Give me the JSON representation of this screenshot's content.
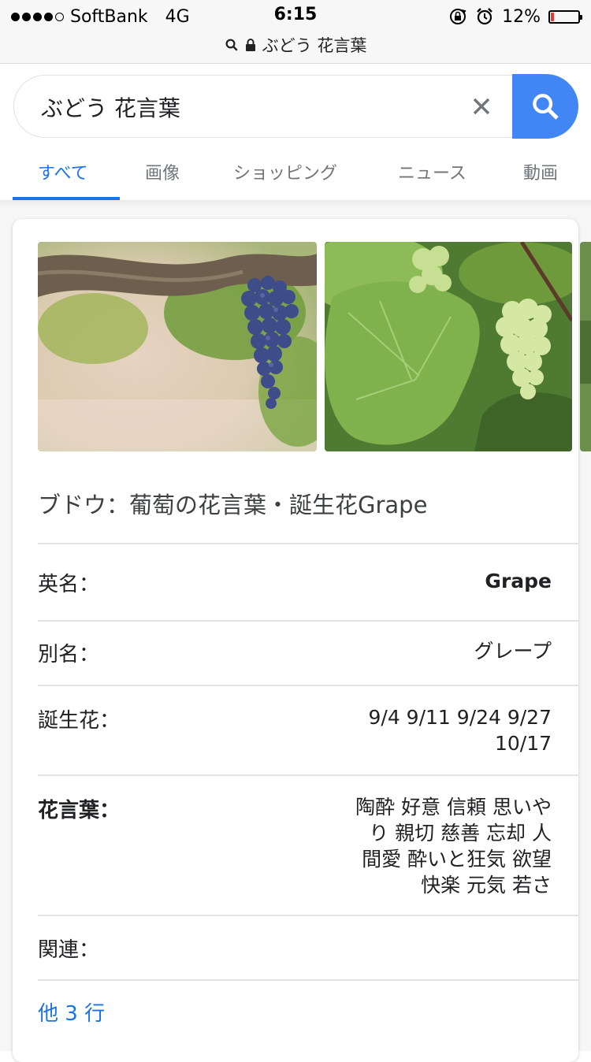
{
  "status_bar": {
    "carrier": "SoftBank",
    "network": "4G",
    "time": "6:15",
    "battery": "12%",
    "battery_level": 0.12,
    "signal_bars_filled": 4,
    "signal_bars_total": 5,
    "icons": [
      "lock-rotation-icon",
      "alarm-icon",
      "battery-icon"
    ]
  },
  "url_bar": {
    "text": "ぶどう 花言葉",
    "icons": [
      "search-icon",
      "lock-icon"
    ]
  },
  "search": {
    "query": "ぶどう 花言葉",
    "clear_icon": "close-icon",
    "submit_icon": "search-icon"
  },
  "tabs": [
    {
      "label": "すべて",
      "active": true
    },
    {
      "label": "画像",
      "active": false
    },
    {
      "label": "ショッピング",
      "active": false
    },
    {
      "label": "ニュース",
      "active": false
    },
    {
      "label": "動画",
      "active": false
    }
  ],
  "card": {
    "images": [
      {
        "desc": "grape-vine-purple"
      },
      {
        "desc": "grape-vine-green"
      },
      {
        "desc": "grape-partial"
      }
    ],
    "title": "ブドウ：葡萄の花言葉・誕生花Grape",
    "rows": [
      {
        "label": "英名：",
        "value_lines": [
          "Grape"
        ]
      },
      {
        "label": "別名：",
        "value_lines": [
          "グレープ"
        ]
      },
      {
        "label": "誕生花：",
        "value_lines": [
          "9/4 9/11 9/24 9/27",
          "10/17"
        ]
      },
      {
        "label": "花言葉：",
        "value_lines": [
          "陶酔 好意 信頼 思いや",
          "り 親切 慈善 忘却 人",
          "間愛 酔いと狂気 欲望",
          "快楽 元気 若さ"
        ]
      },
      {
        "label": "関連：",
        "value_lines": []
      }
    ],
    "more_link": "他 3 行"
  },
  "colors": {
    "accent": "#1a73e8",
    "search_button": "#4285f4",
    "battery_low": "#e53935"
  }
}
